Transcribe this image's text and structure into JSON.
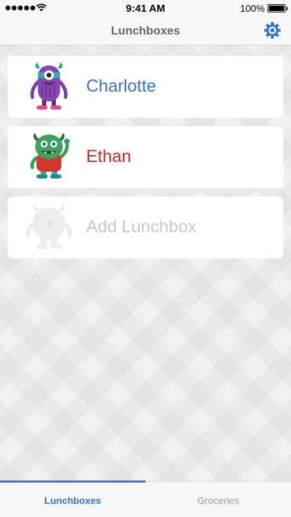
{
  "status_bar": {
    "time": "9:41 AM",
    "battery": "100%",
    "icons": [
      "signal-dots-icon",
      "wifi-icon",
      "battery-icon"
    ]
  },
  "nav": {
    "title": "Lunchboxes",
    "right_icon": "gear-icon"
  },
  "cards": [
    {
      "name": "Charlotte",
      "color": "#3a72c5",
      "icon": "purple-monster-icon"
    },
    {
      "name": "Ethan",
      "color": "#c0282a",
      "icon": "green-monster-icon"
    },
    {
      "name": "Add Lunchbox",
      "color": "#c8c8c8",
      "icon": "add-monster-placeholder-icon"
    }
  ],
  "tabs": [
    {
      "label": "Lunchboxes",
      "active": true
    },
    {
      "label": "Groceries",
      "active": false
    }
  ],
  "colors": {
    "accent": "#3a73c6"
  }
}
